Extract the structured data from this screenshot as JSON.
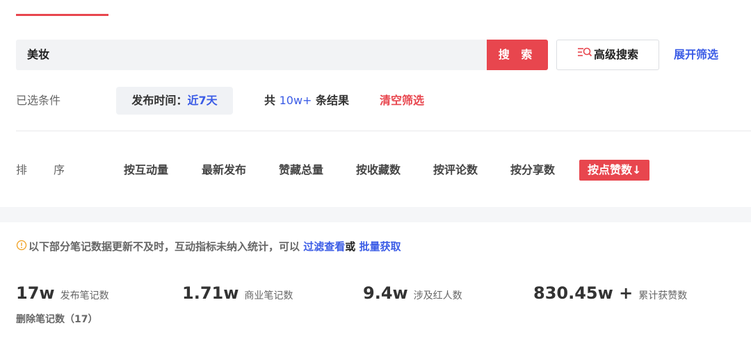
{
  "search": {
    "value": "美妆",
    "button_label": "搜 索"
  },
  "advanced_search_label": "高级搜索",
  "expand_filter_label": "展开筛选",
  "filters": {
    "selected_label": "已选条件",
    "chip_key": "发布时间：",
    "chip_value": "近7天",
    "count_prefix": "共 ",
    "count_value": "10w+",
    "count_suffix": " 条结果",
    "clear_label": "清空筛选"
  },
  "sort": {
    "label_chars": [
      "排",
      "序"
    ],
    "options": [
      "按互动量",
      "最新发布",
      "赞藏总量",
      "按收藏数",
      "按评论数",
      "按分享数"
    ],
    "active": "按点赞数↓"
  },
  "notice": {
    "text": "以下部分笔记数据更新不及时，互动指标未纳入统计，可以 ",
    "link1": "过滤查看",
    "or": "或 ",
    "link2": "批量获取"
  },
  "stats": [
    {
      "value": "17w",
      "label": "发布笔记数"
    },
    {
      "value": "1.71w",
      "label": "商业笔记数"
    },
    {
      "value": "9.4w",
      "label": "涉及红人数"
    },
    {
      "value": "830.45w +",
      "label": "累计获赞数"
    }
  ],
  "deleted_notes": "删除笔记数（17）",
  "colors": {
    "accent": "#e8464e",
    "link": "#3b5ce6"
  }
}
